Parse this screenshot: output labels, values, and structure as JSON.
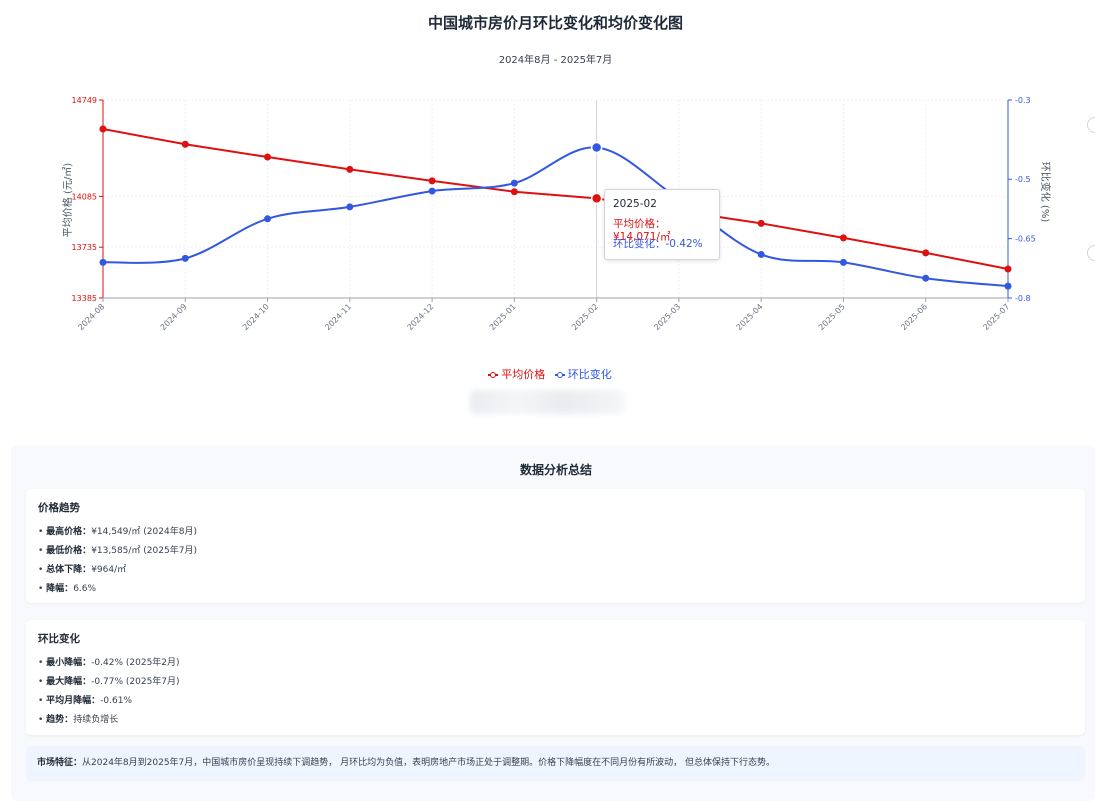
{
  "chart_data": {
    "type": "line",
    "title": "中国城市房价月环比变化和均价变化图",
    "subtitle": "2024年8月 - 2025年7月",
    "categories": [
      "2024-08",
      "2024-09",
      "2024-10",
      "2024-11",
      "2024-12",
      "2025-01",
      "2025-02",
      "2025-03",
      "2025-04",
      "2025-05",
      "2025-06",
      "2025-07"
    ],
    "series": [
      {
        "name": "平均价格",
        "axis": "left",
        "color": "#dd1111",
        "values": [
          14549,
          14444,
          14356,
          14271,
          14192,
          14117,
          14071,
          13984,
          13899,
          13799,
          13696,
          13585
        ]
      },
      {
        "name": "环比变化",
        "axis": "right",
        "color": "#3358e0",
        "values": [
          -0.71,
          -0.7,
          -0.6,
          -0.57,
          -0.53,
          -0.51,
          -0.42,
          -0.55,
          -0.69,
          -0.71,
          -0.75,
          -0.77
        ]
      }
    ],
    "ylabel_left": "平均价格 (元/㎡)",
    "ylabel_right": "环比变化 (%)",
    "ylim_left": [
      13385,
      14749
    ],
    "yticks_left": [
      "14749",
      "14085",
      "13735",
      "13385"
    ],
    "ylim_right": [
      -0.8,
      -0.3
    ],
    "yticks_right": [
      "-0.3",
      "-0.5",
      "-0.65",
      "-0.8"
    ],
    "grid": true,
    "legend": "bottom-center",
    "highlight_index": 6
  },
  "tooltip": {
    "title": "2025-02",
    "line1": "平均价格：¥14,071/㎡",
    "line2": "环比变化：-0.42%"
  },
  "summary": {
    "title": "数据分析总结",
    "price_card": {
      "title": "价格趋势",
      "items": [
        {
          "label": "最高价格：",
          "value": "¥14,549/㎡ (2024年8月)"
        },
        {
          "label": "最低价格：",
          "value": "¥13,585/㎡ (2025年7月)"
        },
        {
          "label": "总体下降：",
          "value": "¥964/㎡"
        },
        {
          "label": "降幅：",
          "value": "6.6%"
        }
      ]
    },
    "mom_card": {
      "title": "环比变化",
      "items": [
        {
          "label": "最小降幅：",
          "value": "-0.42% (2025年2月)"
        },
        {
          "label": "最大降幅：",
          "value": "-0.77% (2025年7月)"
        },
        {
          "label": "平均月降幅：",
          "value": "-0.61%"
        },
        {
          "label": "趋势：",
          "value": "持续负增长"
        }
      ]
    },
    "note_label": "市场特征：",
    "note_text": "从2024年8月到2025年7月，中国城市房价呈现持续下调趋势， 月环比均为负值，表明房地产市场正处于调整期。价格下降幅度在不同月份有所波动， 但总体保持下行态势。"
  }
}
